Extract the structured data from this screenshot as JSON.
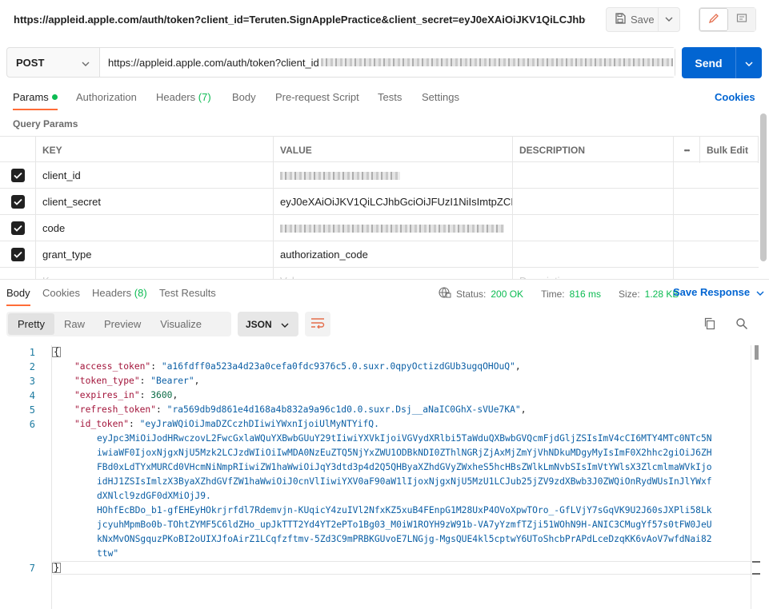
{
  "title_url": "https://appleid.apple.com/auth/token?client_id=Teruten.SignApplePractice&client_secret=eyJ0eXAiOiJKV1QiLCJhbGci...",
  "toolbar": {
    "save_label": "Save"
  },
  "request": {
    "method": "POST",
    "url": "https://appleid.apple.com/auth/token?client_id",
    "send_label": "Send"
  },
  "req_tabs": {
    "params": "Params",
    "authorization": "Authorization",
    "headers": "Headers",
    "headers_count": "(7)",
    "body": "Body",
    "prerequest": "Pre-request Script",
    "tests": "Tests",
    "settings": "Settings",
    "cookies": "Cookies"
  },
  "query_params": {
    "title": "Query Params",
    "columns": {
      "key": "KEY",
      "value": "VALUE",
      "description": "DESCRIPTION",
      "more": "•••",
      "bulk_edit": "Bulk Edit"
    },
    "rows": [
      {
        "key": "client_id",
        "value": ""
      },
      {
        "key": "client_secret",
        "value": "eyJ0eXAiOiJKV1QiLCJhbGciOiJFUzI1NiIsImtpZCI..."
      },
      {
        "key": "code",
        "value": ""
      },
      {
        "key": "grant_type",
        "value": "authorization_code"
      }
    ],
    "placeholders": {
      "key": "Key",
      "value": "Value",
      "description": "Description"
    }
  },
  "resp_tabs": {
    "body": "Body",
    "cookies": "Cookies",
    "headers": "Headers",
    "headers_count": "(8)",
    "test_results": "Test Results"
  },
  "status": {
    "status_label": "Status:",
    "status_value": "200 OK",
    "time_label": "Time:",
    "time_value": "816 ms",
    "size_label": "Size:",
    "size_value": "1.28 KB",
    "save_response": "Save Response"
  },
  "view_modes": {
    "pretty": "Pretty",
    "raw": "Raw",
    "preview": "Preview",
    "visualize": "Visualize"
  },
  "format": "JSON",
  "code": {
    "line_numbers": [
      "1",
      "2",
      "3",
      "4",
      "5",
      "6",
      "7"
    ],
    "open_brace": "{",
    "close_brace": "}",
    "access_token_key": "\"access_token\"",
    "access_token_value": "\"a16fdff0a523a4d23a0cefa0fdc9376c5.0.suxr.0qpyOctizdGUb3ugqOHOuQ\"",
    "token_type_key": "\"token_type\"",
    "token_type_value": "\"Bearer\"",
    "expires_in_key": "\"expires_in\"",
    "expires_in_value": "3600",
    "refresh_token_key": "\"refresh_token\"",
    "refresh_token_value": "\"ra569db9d861e4d168a4b832a9a96c1d0.0.suxr.Dsj__aNaIC0GhX-sVUe7KA\"",
    "id_token_key": "\"id_token\"",
    "id_token_lines": [
      "\"eyJraWQiOiJmaDZCczhDIiwiYWxnIjoiUlMyNTYifQ.",
      "eyJpc3MiOiJodHRwczovL2FwcGxlaWQuYXBwbGUuY29tIiwiYXVkIjoiVGVydXRlbi5TaWduQXBwbGVQcmFjdGljZSIsImV4cCI6MTY4MTc0NTc5N",
      "iwiaWF0IjoxNjgxNjU5Mzk2LCJzdWIiOiIwMDA0NzEuZTQ5NjYxZWU1ODBkNDI0ZThlNGRjZjAxMjZmYjVhNDkuMDgyMyIsImF0X2hhc2giOiJ6ZH",
      "FBd0xLdTYxMURCd0VHcmNiNmpRIiwiZW1haWwiOiJqY3dtd3p4d2Q5QHByaXZhdGVyZWxheS5hcHBsZWlkLmNvbSIsImVtYWlsX3ZlcmlmaWVkIjo",
      "idHJ1ZSIsImlzX3ByaXZhdGVfZW1haWwiOiJ0cnVlIiwiYXV0aF90aW1lIjoxNjgxNjU5MzU1LCJub25jZV9zdXBwb3J0ZWQiOnRydWUsInJlYWxf",
      "dXNlcl9zdGF0dXMiOjJ9.",
      "HOhfEcBDo_b1-gfEHEyHOkrjrfdl7Rdemvjn-KUqicY4zuIVl2NfxKZ5xuB4FEnpG1M28UxP4OVoXpwTOro_-GfLVjY7sGqVK9U2J60sJXPli58Lk",
      "jcyuhMpmBo0b-TOhtZYMF5C6ldZHo_upJkTTT2Yd4YT2ePTo1Bg03_M0iW1ROYH9zW91b-VA7yYzmfTZji51WOhN9H-ANIC3CMugYf57s0tFW0JeU",
      "kNxMvONSgquzPKoBI2oUIXJfoAirZ1LCqfzftmv-5Zd3C9mPRBKGUvoE7LNGjg-MgsQUE4kl5cptwY6UToShcbPrAPdLceDzqKK6vAoV7wfdNai82",
      "ttw\""
    ]
  },
  "colors": {
    "accent": "#0265d2",
    "tab_underline": "#ff6c37",
    "success": "#0cbb52"
  }
}
